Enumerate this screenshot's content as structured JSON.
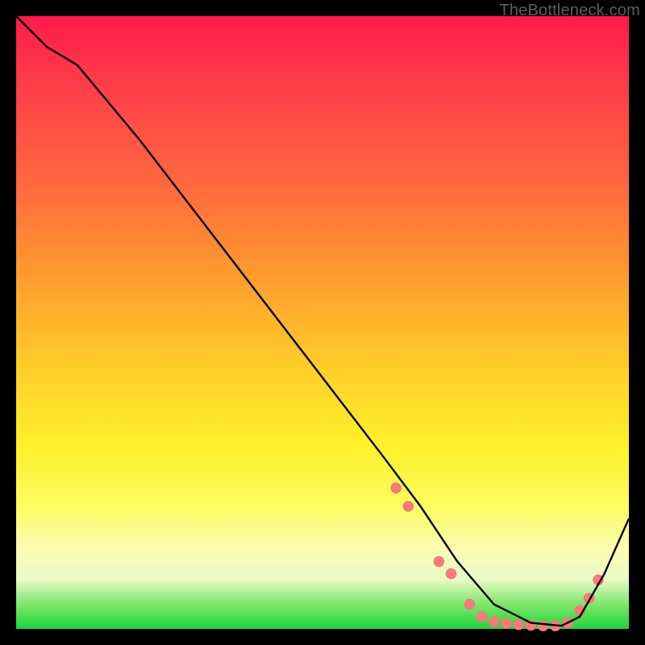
{
  "watermark": "TheBottleneck.com",
  "chart_data": {
    "type": "line",
    "title": "",
    "xlabel": "",
    "ylabel": "",
    "xlim": [
      0,
      100
    ],
    "ylim": [
      0,
      100
    ],
    "grid": false,
    "legend": false,
    "note": "Axes unlabeled; values are relative coordinates inferred from geometry.",
    "series": [
      {
        "name": "curve",
        "color": "#000000",
        "x": [
          0,
          5,
          10,
          20,
          30,
          40,
          50,
          60,
          66,
          72,
          78,
          84,
          89,
          92,
          96,
          100
        ],
        "y": [
          100,
          95,
          92,
          80,
          67,
          54,
          41,
          28,
          20,
          11,
          4,
          1,
          0.5,
          2,
          9,
          18
        ]
      }
    ],
    "markers": {
      "name": "cluster",
      "color": "#f67a7a",
      "radius_rel": 0.9,
      "points": [
        {
          "x": 62,
          "y": 23
        },
        {
          "x": 64,
          "y": 20
        },
        {
          "x": 69,
          "y": 11
        },
        {
          "x": 71,
          "y": 9
        },
        {
          "x": 74,
          "y": 4
        },
        {
          "x": 76,
          "y": 2
        },
        {
          "x": 78,
          "y": 1.2
        },
        {
          "x": 80,
          "y": 0.9
        },
        {
          "x": 82,
          "y": 0.7
        },
        {
          "x": 84,
          "y": 0.6
        },
        {
          "x": 86,
          "y": 0.5
        },
        {
          "x": 88,
          "y": 0.5
        },
        {
          "x": 90,
          "y": 1
        },
        {
          "x": 92,
          "y": 3
        },
        {
          "x": 93.5,
          "y": 5
        },
        {
          "x": 95,
          "y": 8
        }
      ]
    }
  }
}
